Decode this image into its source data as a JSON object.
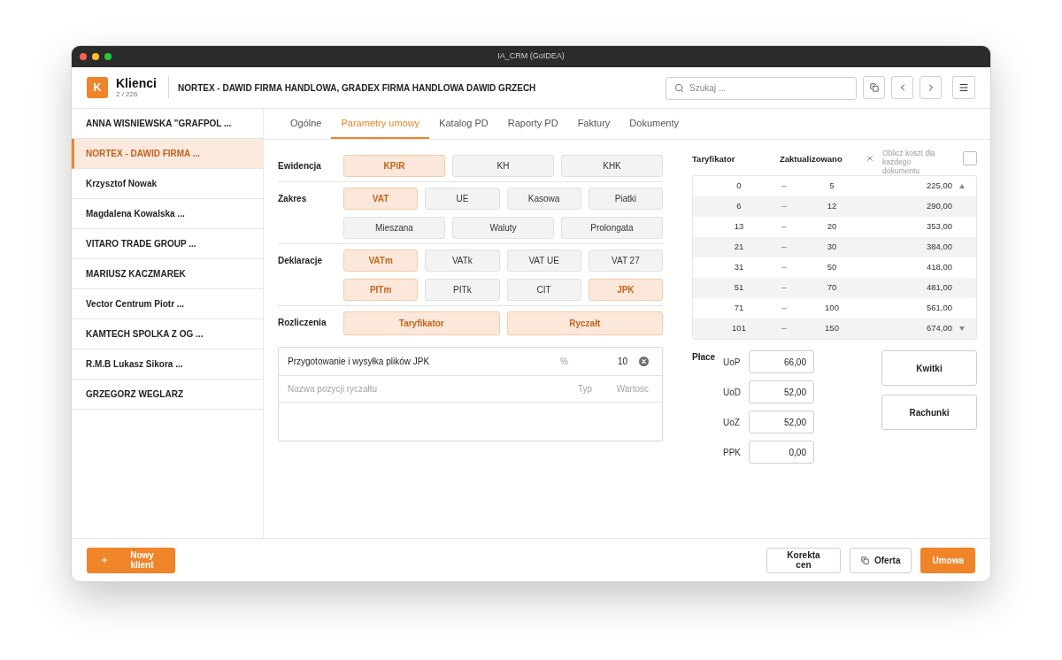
{
  "window": {
    "title": "IA_CRM (GoIDEA)"
  },
  "header": {
    "logo": "K",
    "module": "Klienci",
    "counter": "2 / 226",
    "client_title": "NORTEX - DAWID FIRMA HANDLOWA, GRADEX FIRMA HANDLOWA DAWID GRZECH",
    "search": {
      "placeholder": "Szukaj ..."
    }
  },
  "sidebar": {
    "items": [
      {
        "label": "ANNA WISNIEWSKA \"GRAFPOL ...",
        "selected": false
      },
      {
        "label": "NORTEX - DAWID FIRMA ...",
        "selected": true
      },
      {
        "label": "Krzysztof Nowak",
        "selected": false
      },
      {
        "label": "Magdalena Kowalska ...",
        "selected": false
      },
      {
        "label": "VITARO TRADE GROUP ...",
        "selected": false
      },
      {
        "label": "MARIUSZ KACZMAREK",
        "selected": false
      },
      {
        "label": "Vector Centrum Piotr ...",
        "selected": false
      },
      {
        "label": "KAMTECH SPOLKA Z OG ...",
        "selected": false
      },
      {
        "label": "R.M.B Lukasz Sikora ...",
        "selected": false
      },
      {
        "label": "GRZEGORZ WEGLARZ",
        "selected": false
      }
    ]
  },
  "tabs": [
    {
      "label": "Ogólne",
      "selected": false
    },
    {
      "label": "Parametry umowy",
      "selected": true
    },
    {
      "label": "Katalog PD",
      "selected": false
    },
    {
      "label": "Raporty PD",
      "selected": false
    },
    {
      "label": "Faktury",
      "selected": false
    },
    {
      "label": "Dokumenty",
      "selected": false
    }
  ],
  "settings": [
    {
      "label": "Ewidencja",
      "rows": [
        {
          "options": [
            {
              "label": "KPiR",
              "selected": true
            },
            {
              "label": "KH",
              "selected": false
            },
            {
              "label": "KHK",
              "selected": false
            }
          ]
        }
      ]
    },
    {
      "label": "Zakres",
      "rows": [
        {
          "options": [
            {
              "label": "VAT",
              "selected": true
            },
            {
              "label": "UE",
              "selected": false
            },
            {
              "label": "Kasowa",
              "selected": false
            },
            {
              "label": "Piatki",
              "selected": false
            }
          ]
        },
        {
          "options": [
            {
              "label": "Mieszana",
              "selected": false
            },
            {
              "label": "Waluty",
              "selected": false
            },
            {
              "label": "Prolongata",
              "selected": false
            }
          ]
        }
      ]
    },
    {
      "label": "Deklaracje",
      "rows": [
        {
          "options": [
            {
              "label": "VATm",
              "selected": true
            },
            {
              "label": "VATk",
              "selected": false
            },
            {
              "label": "VAT UE",
              "selected": false
            },
            {
              "label": "VAT 27",
              "selected": false
            }
          ]
        },
        {
          "options": [
            {
              "label": "PITm",
              "selected": true
            },
            {
              "label": "PITk",
              "selected": false
            },
            {
              "label": "CIT",
              "selected": false
            },
            {
              "label": "JPK",
              "selected": true
            }
          ]
        }
      ]
    },
    {
      "label": "Rozliczenia",
      "rows": [
        {
          "options": [
            {
              "label": "Taryfikator",
              "selected": true
            },
            {
              "label": "Ryczałt",
              "selected": true
            }
          ]
        }
      ]
    }
  ],
  "lump_sum": {
    "items": [
      {
        "name": "Przygotowanie i wysyłka plików JPK",
        "type": "%",
        "value": "10"
      }
    ],
    "new_item": {
      "name": {
        "placeholder": "Nazwa pozycji ryczałtu"
      },
      "type": {
        "placeholder": "Typ"
      },
      "value": {
        "placeholder": "Wartosc"
      }
    }
  },
  "tariff": {
    "title": "Taryfikator",
    "status": "Zaktualizowano",
    "per_document": {
      "label": "Oblicz koszt dla każdego dokumentu",
      "checked": false
    },
    "rows": [
      {
        "from": "0",
        "separator": "–",
        "to": "5",
        "price": "225,00"
      },
      {
        "from": "6",
        "separator": "–",
        "to": "12",
        "price": "290,00"
      },
      {
        "from": "13",
        "separator": "–",
        "to": "20",
        "price": "353,00"
      },
      {
        "from": "21",
        "separator": "–",
        "to": "30",
        "price": "384,00"
      },
      {
        "from": "31",
        "separator": "–",
        "to": "50",
        "price": "418,00"
      },
      {
        "from": "51",
        "separator": "–",
        "to": "70",
        "price": "481,00"
      },
      {
        "from": "71",
        "separator": "–",
        "to": "100",
        "price": "561,00"
      },
      {
        "from": "101",
        "separator": "–",
        "to": "150",
        "price": "674,00"
      }
    ]
  },
  "payroll": {
    "title": "Płace",
    "fields": [
      {
        "label": "UoP",
        "value": "66,00"
      },
      {
        "label": "UoD",
        "value": "52,00"
      },
      {
        "label": "UoZ",
        "value": "52,00"
      },
      {
        "label": "PPK",
        "value": "0,00"
      }
    ]
  },
  "document_buttons": [
    {
      "label": "Kwitki"
    },
    {
      "label": "Rachunki"
    }
  ],
  "footer": {
    "new_client": "Nowy klient",
    "buttons": [
      {
        "label": "Korekta cen",
        "kind": "outline"
      },
      {
        "label": "Oferta",
        "kind": "outline_icon"
      },
      {
        "label": "Umowa",
        "kind": "primary"
      }
    ]
  }
}
